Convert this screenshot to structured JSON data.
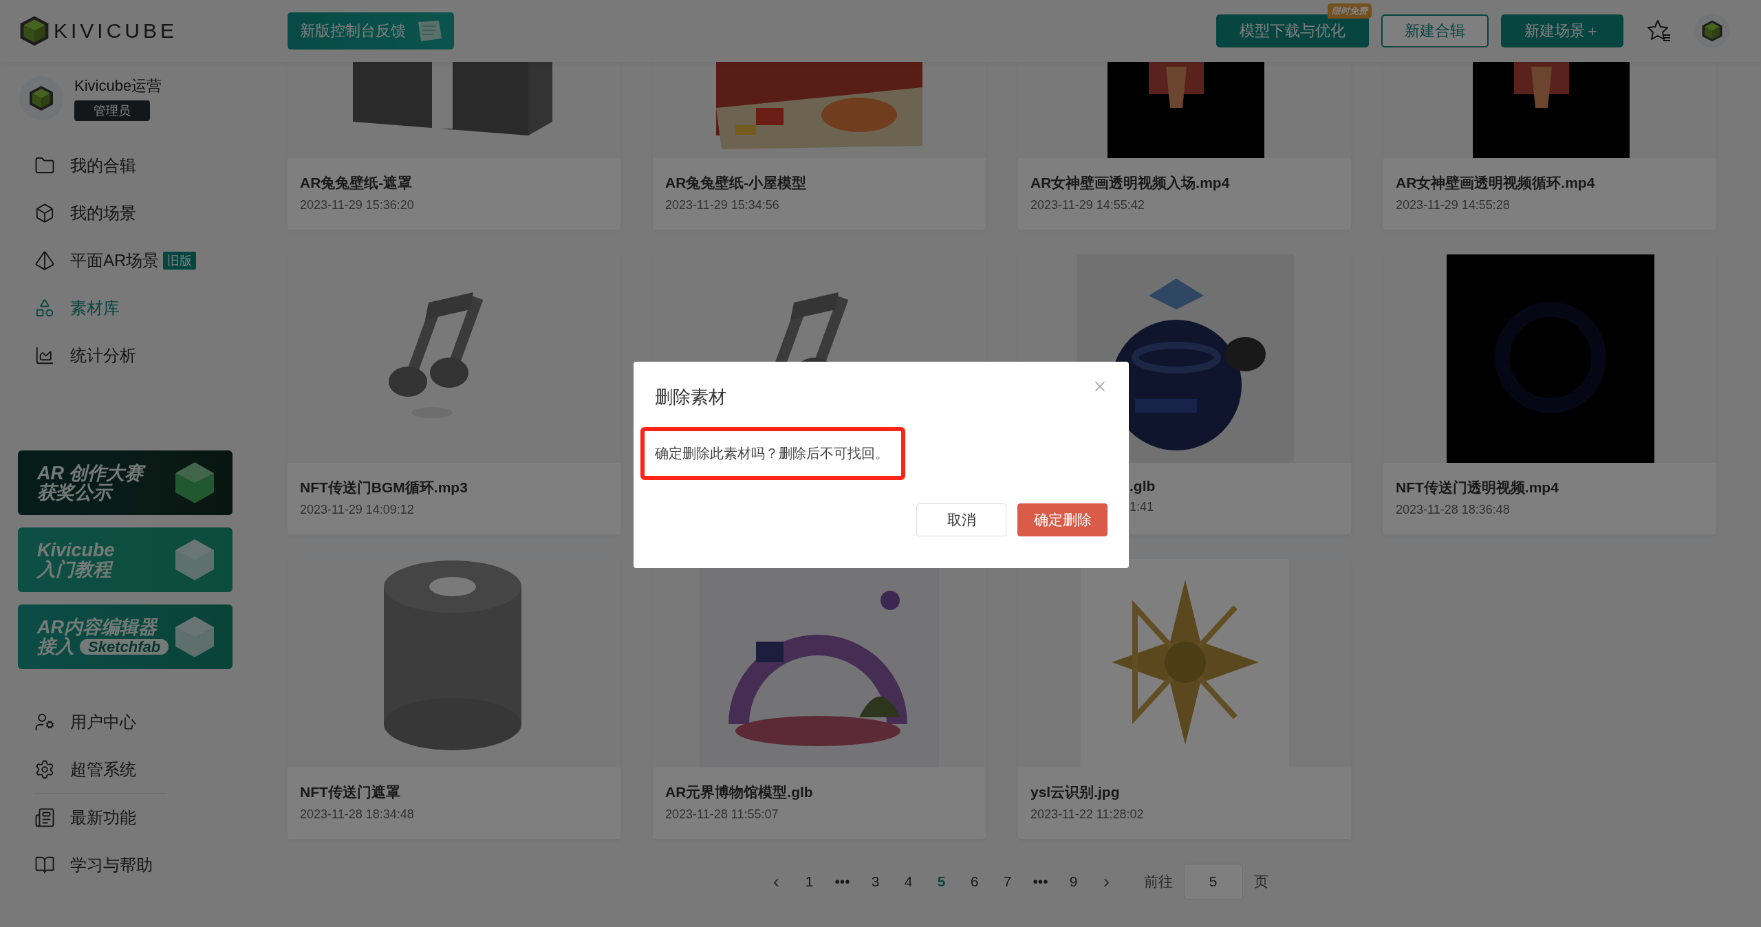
{
  "header": {
    "logo_text": "KIVICUBE",
    "feedback_button": "新版控制台反馈",
    "actions": [
      {
        "label": "模型下载与优化",
        "kind": "primary",
        "badge": "限时免费"
      },
      {
        "label": "新建合辑",
        "kind": "outline"
      },
      {
        "label": "新建场景＋",
        "kind": "primary"
      }
    ]
  },
  "user": {
    "name": "Kivicube运营",
    "role": "管理员"
  },
  "sidebar": {
    "items": [
      {
        "label": "我的合辑",
        "selected": false
      },
      {
        "label": "我的场景",
        "selected": false
      },
      {
        "label": "平面AR场景",
        "selected": false,
        "tag": "旧版"
      },
      {
        "label": "素材库",
        "selected": true
      },
      {
        "label": "统计分析",
        "selected": false
      }
    ],
    "banners": [
      {
        "title": "AR 创作大赛",
        "subtitle": "获奖公示",
        "kind": "dark"
      },
      {
        "title": "Kivicube",
        "subtitle": "入门教程",
        "kind": "teal"
      },
      {
        "title": "AR内容编辑器",
        "subtitle": "接入",
        "pill": "Sketchfab",
        "kind": "blue"
      }
    ],
    "bottom_items": [
      {
        "label": "用户中心"
      },
      {
        "label": "超管系统"
      },
      {
        "label": "最新功能"
      },
      {
        "label": "学习与帮助"
      }
    ]
  },
  "cards": [
    {
      "kind": "picture",
      "title": "AR兔兔壁纸-遮罩",
      "date": "2023-11-29 15:36:20"
    },
    {
      "kind": "picture",
      "title": "AR兔兔壁纸-小屋模型",
      "date": "2023-11-29 15:34:56"
    },
    {
      "kind": "picture",
      "title": "AR女神壁画透明视频入场.mp4",
      "date": "2023-11-29 14:55:42"
    },
    {
      "kind": "picture",
      "title": "AR女神壁画透明视频循环.mp4",
      "date": "2023-11-29 14:55:28"
    },
    {
      "kind": "picture",
      "title": "NFT传送门BGM循环.mp3",
      "date": "2023-11-29 14:09:12"
    },
    {
      "kind": "picture"
    },
    {
      "kind": "covered",
      "title": ".glb",
      "date": "1:41"
    },
    {
      "kind": "picture",
      "title": "NFT传送门透明视频.mp4",
      "date": "2023-11-28 18:36:48"
    },
    {
      "kind": "picture",
      "title": "NFT传送门遮罩",
      "date": "2023-11-28 18:34:48"
    },
    {
      "kind": "picture",
      "title": "AR元界博物馆模型.glb",
      "date": "2023-11-28 11:55:07"
    },
    {
      "kind": "picture",
      "title": "ysl云识别.jpg",
      "date": "2023-11-22 11:28:02"
    }
  ],
  "pagination": {
    "prev": "‹",
    "next": "›",
    "pages": [
      {
        "label": "1",
        "selected": false
      },
      {
        "label": "•••",
        "selected": false
      },
      {
        "label": "3",
        "selected": false
      },
      {
        "label": "4",
        "selected": false
      },
      {
        "label": "5",
        "selected": true
      },
      {
        "label": "6",
        "selected": false
      },
      {
        "label": "7",
        "selected": false
      },
      {
        "label": "•••",
        "selected": false
      },
      {
        "label": "9",
        "selected": false
      }
    ],
    "goto_label": "前往",
    "goto_value": "5",
    "page_suffix": "页"
  },
  "dialog": {
    "title": "删除素材",
    "message": "确定删除此素材吗？删除后不可找回。",
    "highlighted": true,
    "cancel": "取消",
    "confirm": "确定删除"
  }
}
